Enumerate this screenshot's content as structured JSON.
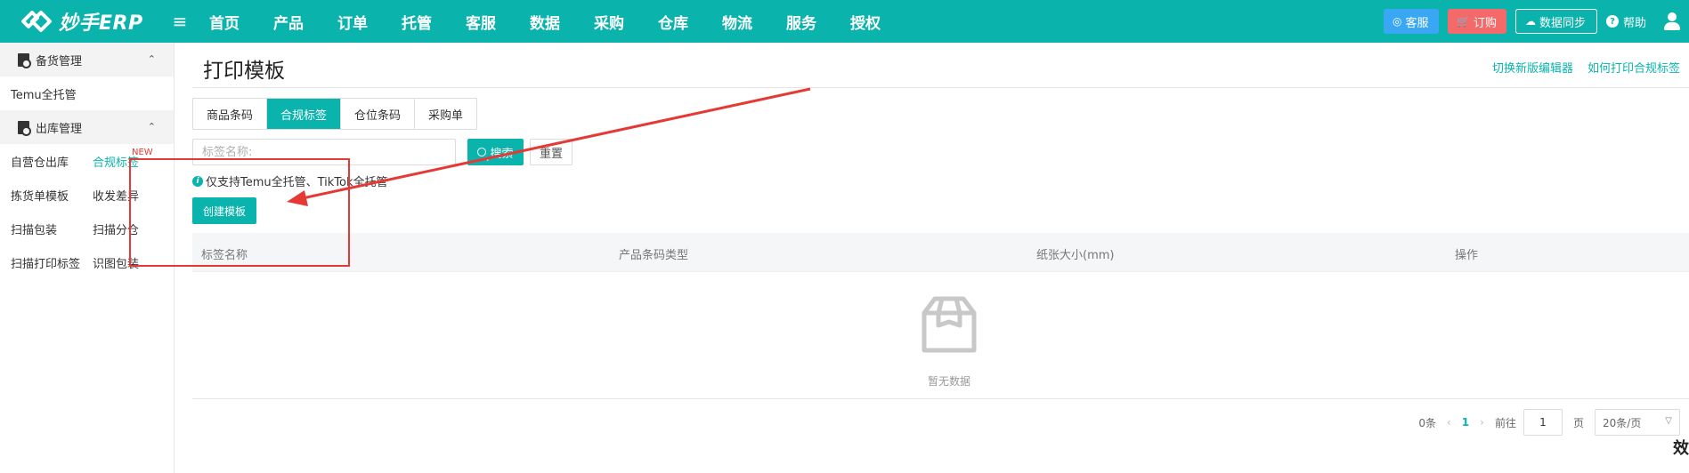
{
  "app": {
    "logo_text": "妙手ERP"
  },
  "nav": [
    "首页",
    "产品",
    "订单",
    "托管",
    "客服",
    "数据",
    "采购",
    "仓库",
    "物流",
    "服务",
    "授权"
  ],
  "top_right": {
    "kefu": "客服",
    "dinggou": "订购",
    "sync": "数据同步",
    "help": "帮助"
  },
  "sidebar": {
    "section1": "备货管理",
    "single": "Temu全托管",
    "section2": "出库管理",
    "new_tag": "NEW",
    "grid": [
      [
        "自营仓出库",
        "合规标签"
      ],
      [
        "拣货单模板",
        "收发差异"
      ],
      [
        "扫描包装",
        "扫描分仓"
      ],
      [
        "扫描打印标签",
        "识图包装"
      ]
    ]
  },
  "page": {
    "title": "打印模板",
    "links": [
      "切换新版编辑器",
      "如何打印合规标签"
    ],
    "tabs": [
      "商品条码",
      "合规标签",
      "仓位条码",
      "采购单"
    ],
    "active_tab": "合规标签",
    "search_placeholder": "标签名称:",
    "search_button": "搜索",
    "reset_button": "重置",
    "notice": "仅支持Temu全托管、TikTok全托管",
    "create_button": "创建模板",
    "columns": [
      "标签名称",
      "产品条码类型",
      "纸张大小(mm)",
      "操作"
    ],
    "empty_text": "暂无数据"
  },
  "pager": {
    "total": "0条",
    "current": "1",
    "goto_label": "前往",
    "page_value": "1",
    "page_unit": "页",
    "page_size": "20条/页"
  },
  "edge_char": "效",
  "colors": {
    "primary": "#0bb3ad",
    "danger": "#f46a6a",
    "info": "#3aa7f4",
    "annotation": "#e53935"
  }
}
